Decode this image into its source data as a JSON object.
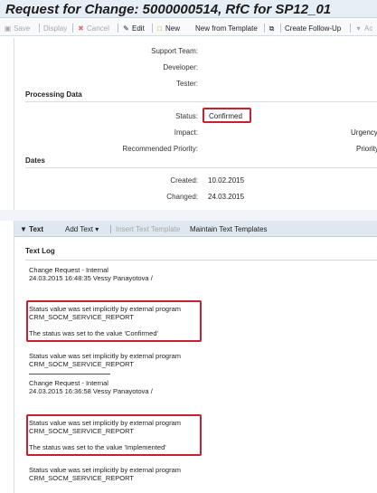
{
  "window": {
    "title": "Request for Change: 5000000514, RfC for SP12_01"
  },
  "toolbar": {
    "save": "Save",
    "display": "Display",
    "cancel": "Cancel",
    "edit": "Edit",
    "new": "New",
    "new_from_template": "New from Template",
    "create_follow_up": "Create Follow-Up",
    "overflow": "Ac"
  },
  "details": {
    "support_team_label": "Support Team:",
    "developer_label": "Developer:",
    "tester_label": "Tester:",
    "processing_section": "Processing Data",
    "status_label": "Status:",
    "status_value": "Confirmed",
    "impact_label": "Impact:",
    "urgency_label": "Urgency",
    "recommended_priority_label": "Recommended Priority:",
    "priority_label": "Priority",
    "dates_section": "Dates",
    "created_label": "Created:",
    "created_value": "10.02.2015",
    "changed_label": "Changed:",
    "changed_value": "24.03.2015"
  },
  "text_panel": {
    "tab": "Text",
    "add_text": "Add Text",
    "insert_template": "Insert Text Template",
    "maintain_templates": "Maintain Text Templates",
    "log_title": "Text Log"
  },
  "log": [
    {
      "type": "Change Request - Internal",
      "meta": "24.03.2015  16:48:35  Vessy Panayotova /",
      "lines": [
        "Status value was set implicitly by external program",
        "CRM_SOCM_SERVICE_REPORT",
        "",
        "The status was set to the value 'Confirmed'"
      ],
      "trailing": [
        "Status value was set implicitly by external program",
        "CRM_SOCM_SERVICE_REPORT"
      ]
    },
    {
      "type": "Change Request - Internal",
      "meta": "24.03.2015  16:36:58  Vessy Panayotova /",
      "lines": [
        "Status value was set implicitly by external program",
        "CRM_SOCM_SERVICE_REPORT",
        "",
        "The status was set to the value 'Implemented'"
      ],
      "trailing": [
        "Status value was set implicitly by external program",
        "CRM_SOCM_SERVICE_REPORT"
      ]
    }
  ],
  "colors": {
    "highlight": "#c8202f",
    "header_bg": "#e6eef6",
    "tabbar_bg": "#dfe8f1"
  }
}
